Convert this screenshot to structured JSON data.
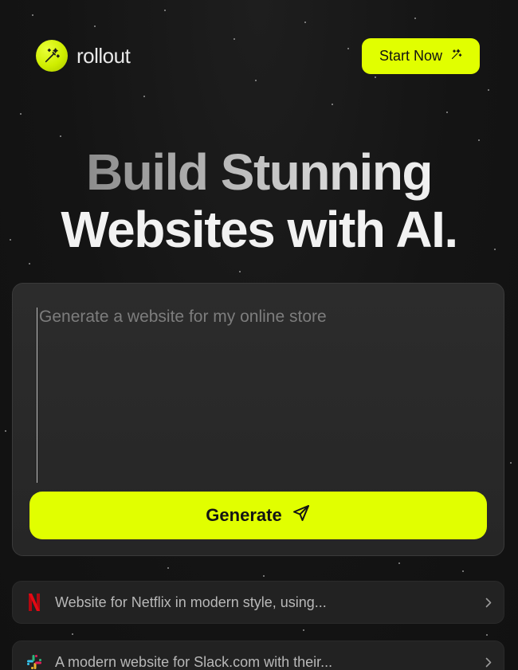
{
  "brand": {
    "name": "rollout",
    "accent_color": "#e1ff00"
  },
  "header": {
    "cta_label": "Start Now",
    "cta_icon": "sparkles-icon"
  },
  "hero": {
    "title_line1": "Build Stunning",
    "title_line2": "Websites with AI."
  },
  "prompt": {
    "value": "",
    "placeholder": "Generate a website for my online store",
    "submit_label": "Generate",
    "submit_icon": "send-icon"
  },
  "suggestions": [
    {
      "icon": "netflix-logo-icon",
      "text": "Website for Netflix in modern style, using..."
    },
    {
      "icon": "slack-logo-icon",
      "text": "A modern website for Slack.com with their..."
    }
  ]
}
